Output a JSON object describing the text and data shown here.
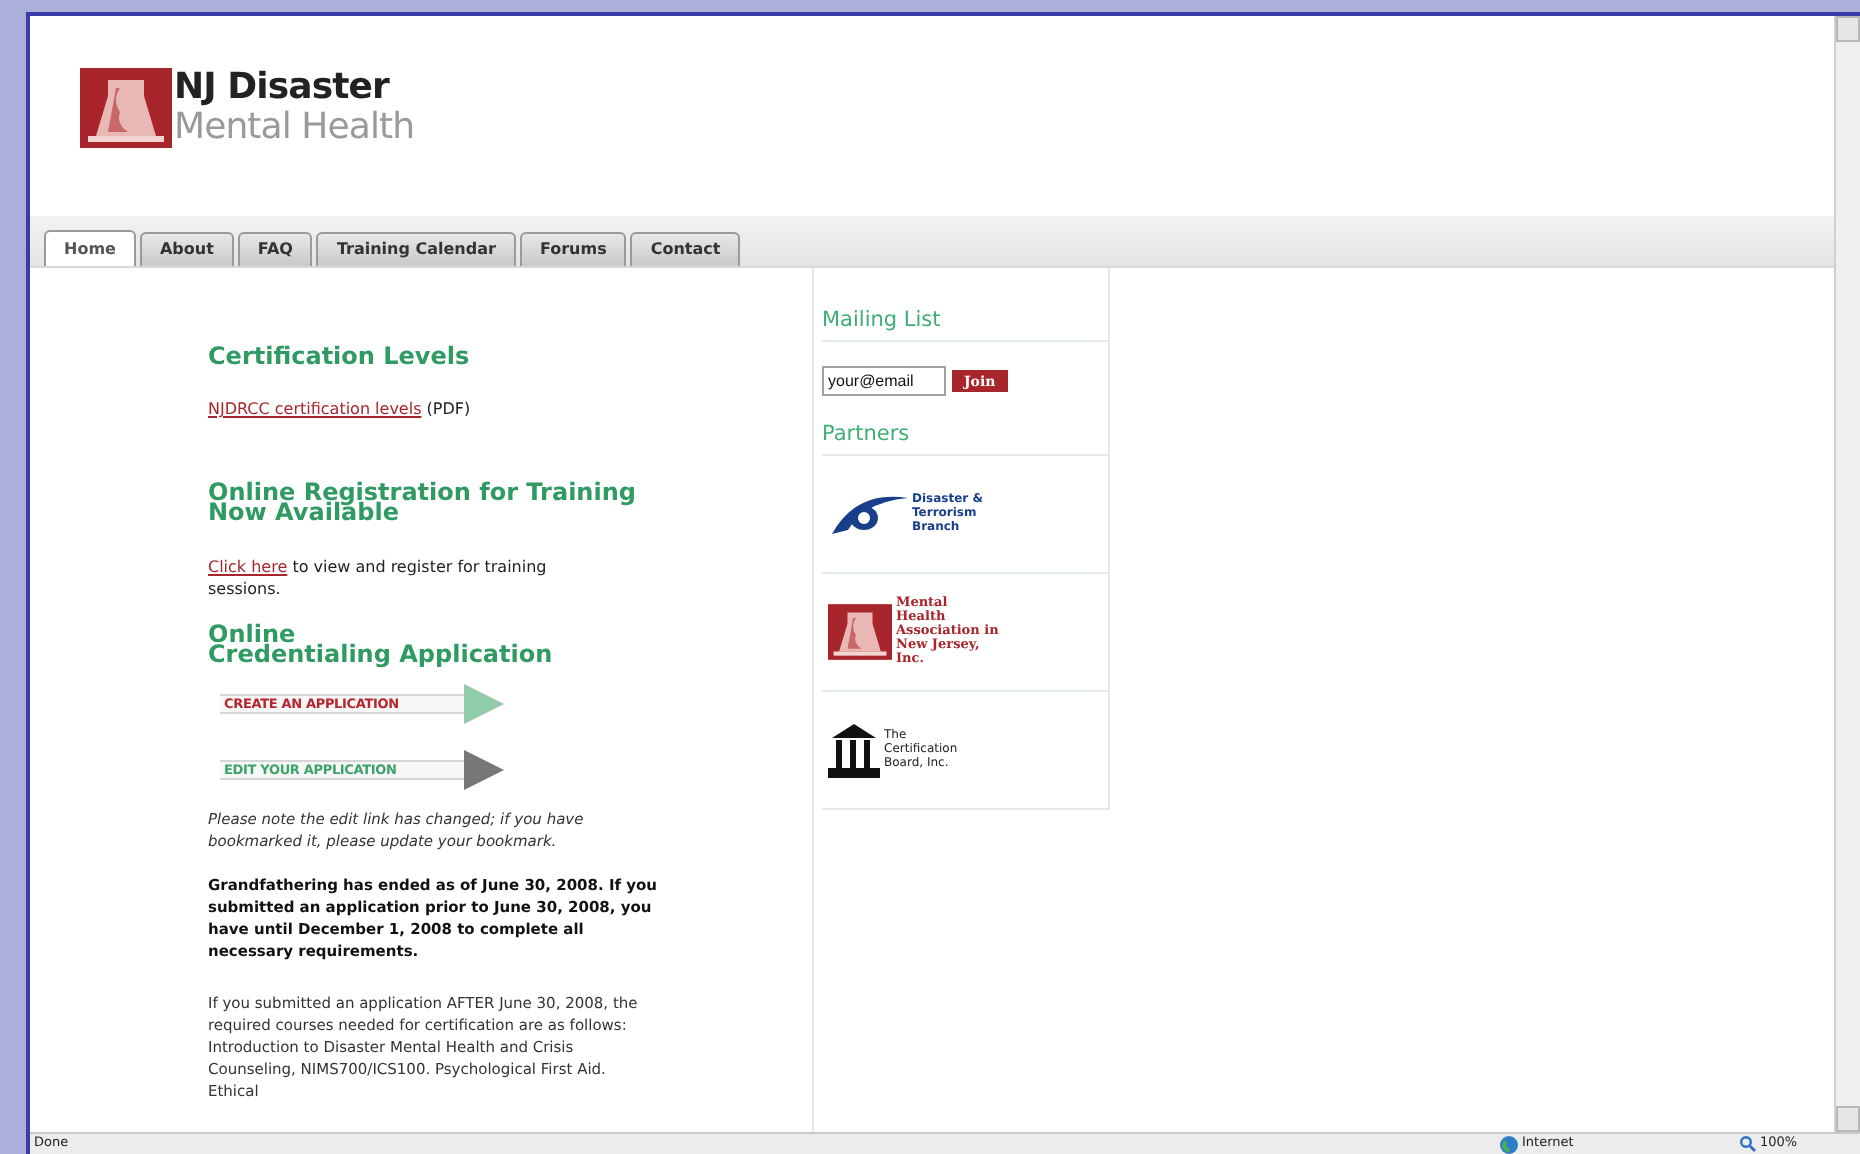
{
  "logo": {
    "line_1": "NJ Disaster",
    "line_2": "Mental Health"
  },
  "tabs": [
    {
      "label": "Home",
      "selected": true
    },
    {
      "label": "About",
      "selected": false
    },
    {
      "label": "FAQ",
      "selected": false
    },
    {
      "label": "Training Calendar",
      "selected": false
    },
    {
      "label": "Forums",
      "selected": false
    },
    {
      "label": "Contact",
      "selected": false
    }
  ],
  "main": {
    "certification": {
      "heading": "Certification Levels",
      "link": "NJDRCC certification levels",
      "suffix": "(PDF)"
    },
    "registration": {
      "heading": "Online Registration for Training Now Available",
      "link": "Click here",
      "text": "to view and register for training sessions."
    },
    "credentialing": {
      "heading_lines": [
        "Online",
        "Credentialing Application"
      ],
      "actions": [
        {
          "label": "CREATE AN APPLICATION",
          "kind": "create"
        },
        {
          "label": "EDIT YOUR APPLICATION",
          "kind": "edit"
        }
      ],
      "note": "Please note the edit link has changed; if you have bookmarked it, please update your bookmark.",
      "notice": "Grandfathering has ended as of June 30, 2008. If you submitted an application prior to June 30, 2008, you have until December 1, 2008 to complete all necessary requirements.",
      "paragraph": "If you submitted an application AFTER June 30, 2008, the required courses needed for certification are as follows: Introduction to Disaster Mental Health and Crisis Counseling, NIMS700/ICS100. Psychological First Aid. Ethical"
    }
  },
  "sidebar": {
    "mailing_list": {
      "heading": "Mailing List",
      "field_value": "your@email",
      "button": "Join"
    },
    "partners": {
      "heading": "Partners",
      "items": [
        {
          "kind": "branch",
          "name": "Disaster & Terrorism Branch"
        },
        {
          "kind": "association",
          "name": "Mental Health Association in New Jersey, Inc."
        },
        {
          "kind": "board",
          "name": "The Certification Board, Inc."
        }
      ]
    }
  },
  "status_bar": {
    "status": "Done",
    "zone": "Internet",
    "zoom": "100%"
  }
}
